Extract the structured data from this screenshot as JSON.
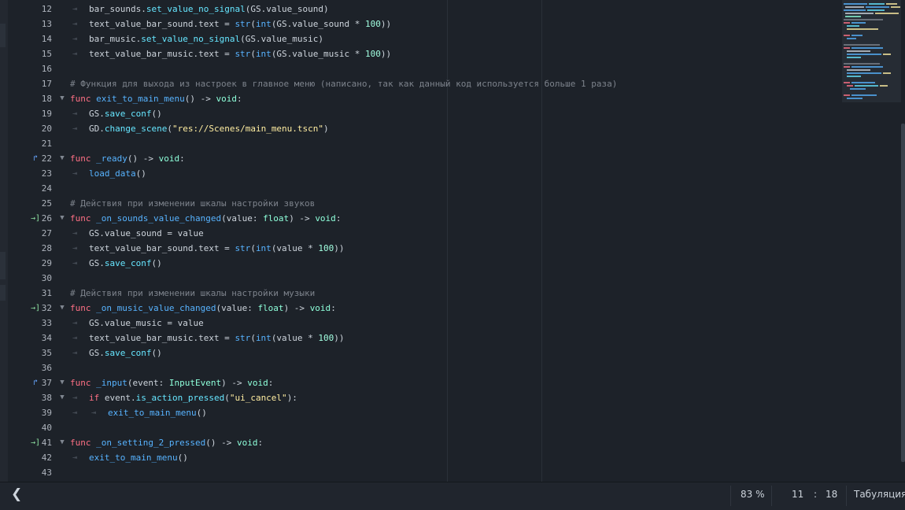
{
  "editor": {
    "lines": [
      {
        "n": "12",
        "indent": 1,
        "tokens": [
          {
            "t": "bar_sounds.",
            "c": "var"
          },
          {
            "t": "set_value_no_signal",
            "c": "met"
          },
          {
            "t": "(GS.value_sound)",
            "c": "plain"
          }
        ]
      },
      {
        "n": "13",
        "indent": 1,
        "tokens": [
          {
            "t": "text_value_bar_sound.text = ",
            "c": "var"
          },
          {
            "t": "str",
            "c": "fn"
          },
          {
            "t": "(",
            "c": "plain"
          },
          {
            "t": "int",
            "c": "fn"
          },
          {
            "t": "(GS.value_sound * ",
            "c": "plain"
          },
          {
            "t": "100",
            "c": "num"
          },
          {
            "t": "))",
            "c": "plain"
          }
        ]
      },
      {
        "n": "14",
        "indent": 1,
        "tokens": [
          {
            "t": "bar_music.",
            "c": "var"
          },
          {
            "t": "set_value_no_signal",
            "c": "met"
          },
          {
            "t": "(GS.value_music)",
            "c": "plain"
          }
        ]
      },
      {
        "n": "15",
        "indent": 1,
        "tokens": [
          {
            "t": "text_value_bar_music.text = ",
            "c": "var"
          },
          {
            "t": "str",
            "c": "fn"
          },
          {
            "t": "(",
            "c": "plain"
          },
          {
            "t": "int",
            "c": "fn"
          },
          {
            "t": "(GS.value_music * ",
            "c": "plain"
          },
          {
            "t": "100",
            "c": "num"
          },
          {
            "t": "))",
            "c": "plain"
          }
        ]
      },
      {
        "n": "16",
        "indent": 0,
        "tokens": []
      },
      {
        "n": "17",
        "indent": 0,
        "tokens": [
          {
            "t": "# Функция для выхода из настроек в главное меню (написано, так как данный код используется больше 1 раза)",
            "c": "cmt"
          }
        ]
      },
      {
        "n": "18",
        "indent": 0,
        "fold": true,
        "tokens": [
          {
            "t": "func",
            "c": "kw"
          },
          {
            "t": " ",
            "c": "plain"
          },
          {
            "t": "exit_to_main_menu",
            "c": "fn"
          },
          {
            "t": "() -> ",
            "c": "plain"
          },
          {
            "t": "void",
            "c": "type"
          },
          {
            "t": ":",
            "c": "plain"
          }
        ]
      },
      {
        "n": "19",
        "indent": 1,
        "tokens": [
          {
            "t": "GS.",
            "c": "var"
          },
          {
            "t": "save_conf",
            "c": "met"
          },
          {
            "t": "()",
            "c": "plain"
          }
        ]
      },
      {
        "n": "20",
        "indent": 1,
        "tokens": [
          {
            "t": "GD.",
            "c": "var"
          },
          {
            "t": "change_scene",
            "c": "met"
          },
          {
            "t": "(",
            "c": "plain"
          },
          {
            "t": "\"res://Scenes/main_menu.tscn\"",
            "c": "str"
          },
          {
            "t": ")",
            "c": "plain"
          }
        ]
      },
      {
        "n": "21",
        "indent": 0,
        "tokens": []
      },
      {
        "n": "22",
        "indent": 0,
        "fold": true,
        "gutter": "override",
        "tokens": [
          {
            "t": "func",
            "c": "kw"
          },
          {
            "t": " ",
            "c": "plain"
          },
          {
            "t": "_ready",
            "c": "fn"
          },
          {
            "t": "() -> ",
            "c": "plain"
          },
          {
            "t": "void",
            "c": "type"
          },
          {
            "t": ":",
            "c": "plain"
          }
        ]
      },
      {
        "n": "23",
        "indent": 1,
        "tokens": [
          {
            "t": "load_data",
            "c": "fn"
          },
          {
            "t": "()",
            "c": "plain"
          }
        ]
      },
      {
        "n": "24",
        "indent": 0,
        "tokens": []
      },
      {
        "n": "25",
        "indent": 0,
        "tokens": [
          {
            "t": "# Действия при изменении шкалы настройки звуков",
            "c": "cmt"
          }
        ]
      },
      {
        "n": "26",
        "indent": 0,
        "fold": true,
        "gutter": "connected",
        "tokens": [
          {
            "t": "func",
            "c": "kw"
          },
          {
            "t": " ",
            "c": "plain"
          },
          {
            "t": "_on_sounds_value_changed",
            "c": "fn"
          },
          {
            "t": "(value: ",
            "c": "plain"
          },
          {
            "t": "float",
            "c": "type"
          },
          {
            "t": ") -> ",
            "c": "plain"
          },
          {
            "t": "void",
            "c": "type"
          },
          {
            "t": ":",
            "c": "plain"
          }
        ]
      },
      {
        "n": "27",
        "indent": 1,
        "tokens": [
          {
            "t": "GS.value_sound = value",
            "c": "var"
          }
        ]
      },
      {
        "n": "28",
        "indent": 1,
        "tokens": [
          {
            "t": "text_value_bar_sound.text = ",
            "c": "var"
          },
          {
            "t": "str",
            "c": "fn"
          },
          {
            "t": "(",
            "c": "plain"
          },
          {
            "t": "int",
            "c": "fn"
          },
          {
            "t": "(value * ",
            "c": "plain"
          },
          {
            "t": "100",
            "c": "num"
          },
          {
            "t": "))",
            "c": "plain"
          }
        ]
      },
      {
        "n": "29",
        "indent": 1,
        "tokens": [
          {
            "t": "GS.",
            "c": "var"
          },
          {
            "t": "save_conf",
            "c": "met"
          },
          {
            "t": "()",
            "c": "plain"
          }
        ]
      },
      {
        "n": "30",
        "indent": 0,
        "tokens": []
      },
      {
        "n": "31",
        "indent": 0,
        "tokens": [
          {
            "t": "# Действия при изменении шкалы настройки музыки",
            "c": "cmt"
          }
        ]
      },
      {
        "n": "32",
        "indent": 0,
        "fold": true,
        "gutter": "connected",
        "tokens": [
          {
            "t": "func",
            "c": "kw"
          },
          {
            "t": " ",
            "c": "plain"
          },
          {
            "t": "_on_music_value_changed",
            "c": "fn"
          },
          {
            "t": "(value: ",
            "c": "plain"
          },
          {
            "t": "float",
            "c": "type"
          },
          {
            "t": ") -> ",
            "c": "plain"
          },
          {
            "t": "void",
            "c": "type"
          },
          {
            "t": ":",
            "c": "plain"
          }
        ]
      },
      {
        "n": "33",
        "indent": 1,
        "tokens": [
          {
            "t": "GS.value_music = value",
            "c": "var"
          }
        ]
      },
      {
        "n": "34",
        "indent": 1,
        "tokens": [
          {
            "t": "text_value_bar_music.text = ",
            "c": "var"
          },
          {
            "t": "str",
            "c": "fn"
          },
          {
            "t": "(",
            "c": "plain"
          },
          {
            "t": "int",
            "c": "fn"
          },
          {
            "t": "(value * ",
            "c": "plain"
          },
          {
            "t": "100",
            "c": "num"
          },
          {
            "t": "))",
            "c": "plain"
          }
        ]
      },
      {
        "n": "35",
        "indent": 1,
        "tokens": [
          {
            "t": "GS.",
            "c": "var"
          },
          {
            "t": "save_conf",
            "c": "met"
          },
          {
            "t": "()",
            "c": "plain"
          }
        ]
      },
      {
        "n": "36",
        "indent": 0,
        "tokens": []
      },
      {
        "n": "37",
        "indent": 0,
        "fold": true,
        "gutter": "override",
        "tokens": [
          {
            "t": "func",
            "c": "kw"
          },
          {
            "t": " ",
            "c": "plain"
          },
          {
            "t": "_input",
            "c": "fn"
          },
          {
            "t": "(event: ",
            "c": "plain"
          },
          {
            "t": "InputEvent",
            "c": "type"
          },
          {
            "t": ") -> ",
            "c": "plain"
          },
          {
            "t": "void",
            "c": "type"
          },
          {
            "t": ":",
            "c": "plain"
          }
        ]
      },
      {
        "n": "38",
        "indent": 1,
        "fold": true,
        "tokens": [
          {
            "t": "if",
            "c": "kw"
          },
          {
            "t": " event.",
            "c": "var"
          },
          {
            "t": "is_action_pressed",
            "c": "met"
          },
          {
            "t": "(",
            "c": "plain"
          },
          {
            "t": "\"ui_cancel\"",
            "c": "str"
          },
          {
            "t": "):",
            "c": "plain"
          }
        ]
      },
      {
        "n": "39",
        "indent": 2,
        "tokens": [
          {
            "t": "exit_to_main_menu",
            "c": "fn"
          },
          {
            "t": "()",
            "c": "plain"
          }
        ]
      },
      {
        "n": "40",
        "indent": 0,
        "tokens": []
      },
      {
        "n": "41",
        "indent": 0,
        "fold": true,
        "gutter": "connected",
        "tokens": [
          {
            "t": "func",
            "c": "kw"
          },
          {
            "t": " ",
            "c": "plain"
          },
          {
            "t": "_on_setting_2_pressed",
            "c": "fn"
          },
          {
            "t": "() -> ",
            "c": "plain"
          },
          {
            "t": "void",
            "c": "type"
          },
          {
            "t": ":",
            "c": "plain"
          }
        ]
      },
      {
        "n": "42",
        "indent": 1,
        "tokens": [
          {
            "t": "exit_to_main_menu",
            "c": "fn"
          },
          {
            "t": "()",
            "c": "plain"
          }
        ]
      },
      {
        "n": "43",
        "indent": 0,
        "tokens": []
      }
    ],
    "gutter_icons": {
      "connected": {
        "glyph": "→]",
        "name": "signal-connected-icon"
      },
      "override": {
        "glyph": "↱",
        "name": "method-override-icon"
      }
    },
    "fold_glyph": "▼",
    "tab_glyph": "⇥",
    "colors": {
      "keyword": "#ff7085",
      "function": "#57b3ff",
      "member": "#66e6ff",
      "string": "#ffeda1",
      "number": "#a1ffe0",
      "comment": "#7d838c",
      "type": "#8effda",
      "text": "#cdd4dc",
      "background": "#1d2229"
    }
  },
  "statusbar": {
    "collapse_icon": "❮",
    "zoom": "83 %",
    "cursor_line": "11",
    "cursor_separator": ":",
    "cursor_column": "18",
    "indent_mode": "Табуляция"
  }
}
